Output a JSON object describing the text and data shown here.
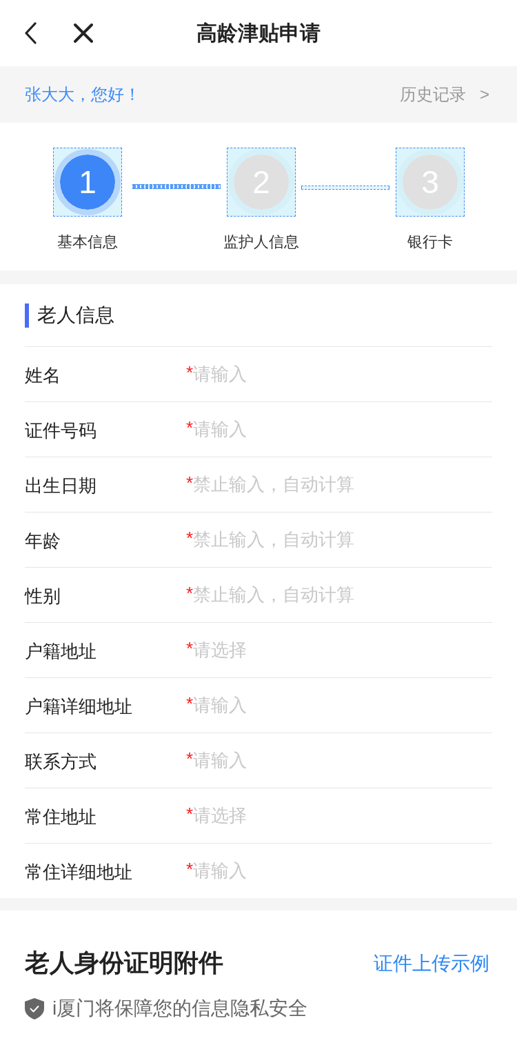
{
  "header": {
    "title": "高龄津贴申请"
  },
  "greeting": {
    "text": "张大大，您好！",
    "history_link": "历史记录",
    "history_arrow": ">"
  },
  "steps": [
    {
      "number": "1",
      "label": "基本信息",
      "selected": true
    },
    {
      "number": "2",
      "label": "监护人信息",
      "selected": false
    },
    {
      "number": "3",
      "label": "银行卡",
      "selected": false
    }
  ],
  "elder_info": {
    "title": "老人信息",
    "fields": [
      {
        "label": "姓名",
        "required_mark": "*",
        "placeholder": "请输入"
      },
      {
        "label": "证件号码",
        "required_mark": "*",
        "placeholder": "请输入"
      },
      {
        "label": "出生日期",
        "required_mark": "*",
        "placeholder": "禁止输入，自动计算"
      },
      {
        "label": "年龄",
        "required_mark": "*",
        "placeholder": "禁止输入，自动计算"
      },
      {
        "label": "性别",
        "required_mark": "*",
        "placeholder": "禁止输入，自动计算"
      },
      {
        "label": "户籍地址",
        "required_mark": "*",
        "placeholder": "请选择"
      },
      {
        "label": "户籍详细地址",
        "required_mark": "*",
        "placeholder": "请输入"
      },
      {
        "label": "联系方式",
        "required_mark": "*",
        "placeholder": "请输入"
      },
      {
        "label": "常住地址",
        "required_mark": "*",
        "placeholder": "请选择"
      },
      {
        "label": "常住详细地址",
        "required_mark": "*",
        "placeholder": "请输入"
      }
    ]
  },
  "attachments": {
    "title": "老人身份证明附件",
    "example_link": "证件上传示例",
    "privacy_notice": "i厦门将保障您的信息隐私安全"
  }
}
